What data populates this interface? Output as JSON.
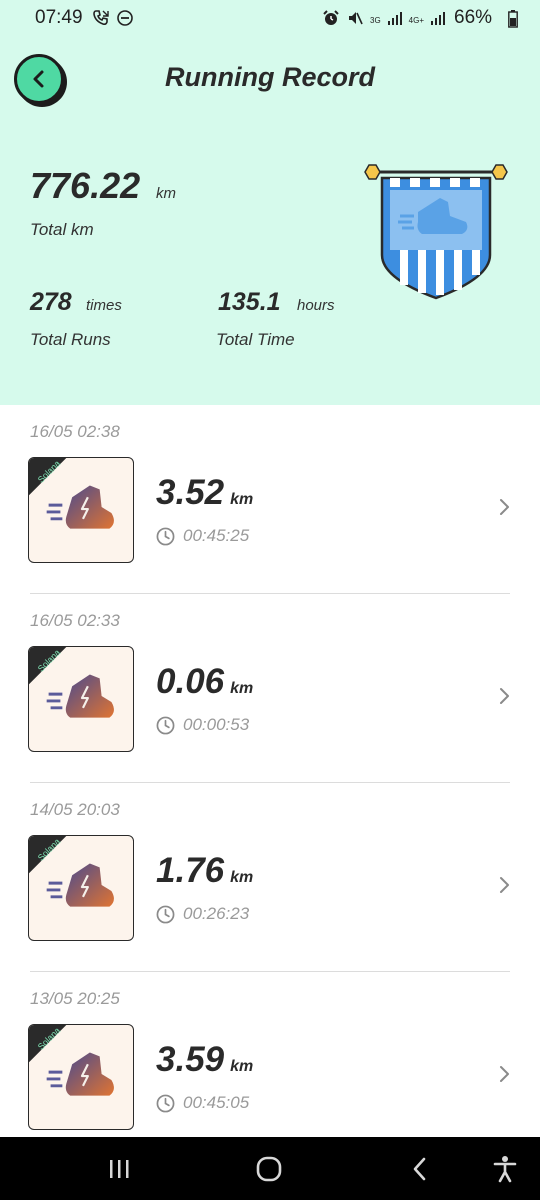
{
  "status_bar": {
    "time": "07:49",
    "battery": "66%",
    "network_left": "3G",
    "network_right": "4G+",
    "icons": [
      "wifi-call-icon",
      "dnd-icon",
      "alarm-icon",
      "mute-icon",
      "signal-icon",
      "battery-icon"
    ]
  },
  "header": {
    "title": "Running Record",
    "back_icon": "back-arrow-icon"
  },
  "summary": {
    "total_km_value": "776.22",
    "total_km_unit": "km",
    "total_km_label": "Total km",
    "total_runs_value": "278",
    "total_runs_unit": "times",
    "total_runs_label": "Total Runs",
    "total_time_value": "135.1",
    "total_time_unit": "hours",
    "total_time_label": "Total Time",
    "badge_icon": "sneaker-banner-icon"
  },
  "records": [
    {
      "date": "16/05 02:38",
      "distance": "3.52",
      "unit": "km",
      "duration": "00:45:25",
      "tag": "Solana"
    },
    {
      "date": "16/05 02:33",
      "distance": "0.06",
      "unit": "km",
      "duration": "00:00:53",
      "tag": "Solana"
    },
    {
      "date": "14/05 20:03",
      "distance": "1.76",
      "unit": "km",
      "duration": "00:26:23",
      "tag": "Solana"
    },
    {
      "date": "13/05 20:25",
      "distance": "3.59",
      "unit": "km",
      "duration": "00:45:05",
      "tag": "Solana"
    }
  ],
  "nav_bar": {
    "icons": [
      "recent-apps-icon",
      "home-icon",
      "back-icon",
      "accessibility-icon"
    ]
  },
  "colors": {
    "header_bg": "#d6faec",
    "accent": "#4fd9a3",
    "badge_blue": "#3d8ee0",
    "shoe_gradient_start": "#5a4a8a",
    "shoe_gradient_end": "#e0743a"
  }
}
